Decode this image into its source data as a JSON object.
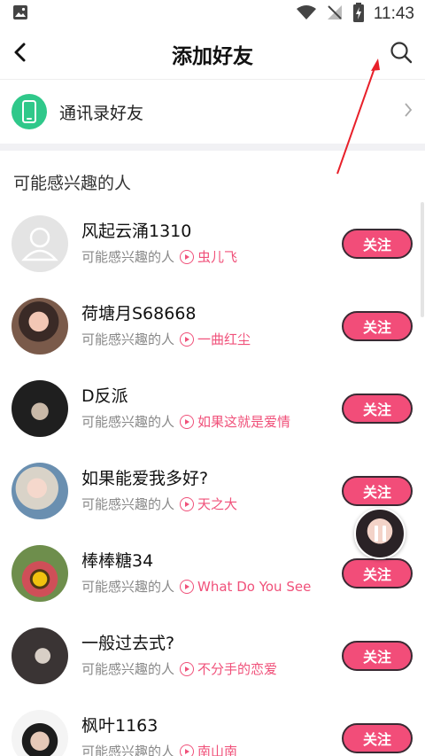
{
  "status_bar": {
    "time": "11:43"
  },
  "header": {
    "title": "添加好友"
  },
  "contacts": {
    "label": "通讯录好友"
  },
  "section": {
    "title": "可能感兴趣的人"
  },
  "users": [
    {
      "name": "风起云涌1310",
      "reason": "可能感兴趣的人",
      "music": "虫儿飞",
      "follow": "关注"
    },
    {
      "name": "荷塘月S68668",
      "reason": "可能感兴趣的人",
      "music": "一曲红尘",
      "follow": "关注"
    },
    {
      "name": "D反派",
      "reason": "可能感兴趣的人",
      "music": "如果这就是爱情",
      "follow": "关注"
    },
    {
      "name": "如果能爱我多好?",
      "reason": "可能感兴趣的人",
      "music": "天之大",
      "follow": "关注"
    },
    {
      "name": "棒棒糖34",
      "reason": "可能感兴趣的人",
      "music": "What Do You See",
      "follow": "关注"
    },
    {
      "name": "一般过去式?",
      "reason": "可能感兴趣的人",
      "music": "不分手的恋爱",
      "follow": "关注"
    },
    {
      "name": "枫叶1163",
      "reason": "可能感兴趣的人",
      "music": "南山南",
      "follow": "关注"
    }
  ],
  "colors": {
    "accent": "#f24d79",
    "contacts_green": "#2fc88a",
    "annotation_arrow": "#e8202a"
  }
}
